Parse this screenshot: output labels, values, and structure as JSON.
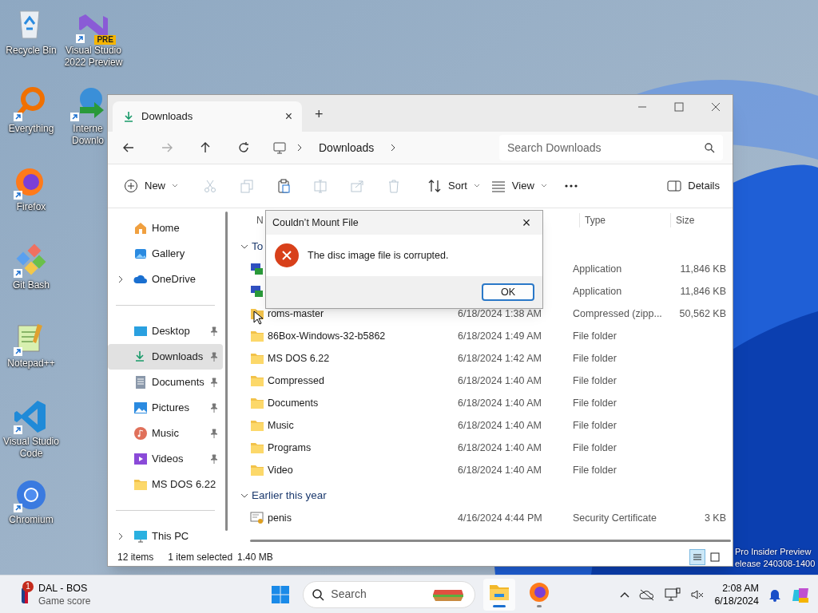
{
  "desktop_icons": [
    {
      "label": "Recycle Bin",
      "kind": "recycle",
      "shortcut": false
    },
    {
      "label": "Everything",
      "kind": "everything",
      "shortcut": true
    },
    {
      "label": "Firefox",
      "kind": "firefox",
      "shortcut": true
    },
    {
      "label": "Git Bash",
      "kind": "git",
      "shortcut": true
    },
    {
      "label": "Notepad++",
      "kind": "notepad",
      "shortcut": true
    },
    {
      "label": "Visual Studio Code",
      "kind": "vscode",
      "shortcut": true
    },
    {
      "label": "Chromium",
      "kind": "chromium",
      "shortcut": true
    },
    {
      "label": "Visual Studio 2022 Preview",
      "kind": "vs",
      "shortcut": true,
      "badge": "PRE"
    },
    {
      "label": "Interne Downlo",
      "kind": "idm",
      "shortcut": true
    }
  ],
  "desktop_watermark": [
    "Pro Insider Preview",
    "elease 240308-1400"
  ],
  "window": {
    "tab": {
      "title": "Downloads",
      "close": "×",
      "new_tab": "+"
    },
    "address": {
      "path": [
        "Downloads"
      ],
      "search_placeholder": "Search Downloads"
    },
    "toolbar": [
      {
        "kind": "new",
        "label": "New",
        "caret": true,
        "disabled": false
      },
      {
        "kind": "cut",
        "caret": false,
        "disabled": true
      },
      {
        "kind": "copy",
        "caret": false,
        "disabled": true
      },
      {
        "kind": "paste",
        "caret": false,
        "disabled": false
      },
      {
        "kind": "rename",
        "caret": false,
        "disabled": true
      },
      {
        "kind": "share",
        "caret": false,
        "disabled": true
      },
      {
        "kind": "delete",
        "caret": false,
        "disabled": true
      },
      {
        "kind": "sort",
        "label": "Sort",
        "caret": true,
        "disabled": false
      },
      {
        "kind": "view",
        "label": "View",
        "caret": true,
        "disabled": false
      },
      {
        "kind": "more",
        "caret": false,
        "disabled": false
      }
    ],
    "details_button": "Details",
    "sidebar": [
      {
        "label": "Home",
        "kind": "home",
        "expandable": false,
        "pinned": false,
        "selected": false
      },
      {
        "label": "Gallery",
        "kind": "gallery",
        "expandable": false,
        "pinned": false,
        "selected": false
      },
      {
        "label": "OneDrive",
        "kind": "cloud",
        "expandable": true,
        "pinned": false,
        "selected": false
      },
      {
        "kind": "divider"
      },
      {
        "label": "Desktop",
        "kind": "desktop",
        "expandable": false,
        "pinned": true,
        "selected": false
      },
      {
        "label": "Downloads",
        "kind": "download",
        "expandable": false,
        "pinned": true,
        "selected": true
      },
      {
        "label": "Documents",
        "kind": "document",
        "expandable": false,
        "pinned": true,
        "selected": false
      },
      {
        "label": "Pictures",
        "kind": "picture",
        "expandable": false,
        "pinned": true,
        "selected": false
      },
      {
        "label": "Music",
        "kind": "music",
        "expandable": false,
        "pinned": true,
        "selected": false
      },
      {
        "label": "Videos",
        "kind": "video",
        "expandable": false,
        "pinned": true,
        "selected": false
      },
      {
        "label": "MS DOS 6.22",
        "kind": "folder",
        "expandable": false,
        "pinned": false,
        "selected": false
      },
      {
        "kind": "divider"
      },
      {
        "label": "This PC",
        "kind": "pc",
        "expandable": true,
        "pinned": false,
        "selected": false
      }
    ],
    "columns": {
      "column_1": "N",
      "type": "Type",
      "size": "Size"
    },
    "groups": [
      {
        "label": "To",
        "files": [
          {
            "kind": "app",
            "type": "Application",
            "size": "11,846 KB"
          },
          {
            "kind": "app",
            "type": "Application",
            "size": "11,846 KB"
          },
          {
            "kind": "zip",
            "name": "roms-master",
            "date": "6/18/2024 1:38 AM",
            "type": "Compressed (zipp...",
            "size": "50,562 KB"
          },
          {
            "kind": "folder",
            "name": "86Box-Windows-32-b5862",
            "date": "6/18/2024 1:49 AM",
            "type": "File folder"
          },
          {
            "kind": "folder",
            "name": "MS DOS 6.22",
            "date": "6/18/2024 1:42 AM",
            "type": "File folder"
          },
          {
            "kind": "folder",
            "name": "Compressed",
            "date": "6/18/2024 1:40 AM",
            "type": "File folder"
          },
          {
            "kind": "folder",
            "name": "Documents",
            "date": "6/18/2024 1:40 AM",
            "type": "File folder"
          },
          {
            "kind": "folder",
            "name": "Music",
            "date": "6/18/2024 1:40 AM",
            "type": "File folder"
          },
          {
            "kind": "folder",
            "name": "Programs",
            "date": "6/18/2024 1:40 AM",
            "type": "File folder"
          },
          {
            "kind": "folder",
            "name": "Video",
            "date": "6/18/2024 1:40 AM",
            "type": "File folder"
          }
        ]
      },
      {
        "label": "Earlier this year",
        "files": [
          {
            "kind": "cert",
            "name": "penis",
            "date": "4/16/2024 4:44 PM",
            "type": "Security Certificate",
            "size": "3 KB"
          }
        ]
      }
    ],
    "status": {
      "count": "12 items",
      "selection": "1 item selected",
      "selection_size": "1.40 MB",
      "views": [
        {
          "kind": "details",
          "selected": true
        },
        {
          "kind": "tiles",
          "selected": false
        }
      ]
    }
  },
  "dialog": {
    "title": "Couldn’t Mount File",
    "close": "×",
    "message": "The disc image file is corrupted.",
    "button": "OK"
  },
  "taskbar": {
    "widget": {
      "badge": "1",
      "title": "DAL - BOS",
      "subtitle": "Game score"
    },
    "search_placeholder": "Search",
    "apps": [
      {
        "kind": "explorer",
        "active": true
      },
      {
        "kind": "firefox",
        "active": false
      }
    ],
    "time": "2:08 AM",
    "date": "6/18/2024"
  }
}
